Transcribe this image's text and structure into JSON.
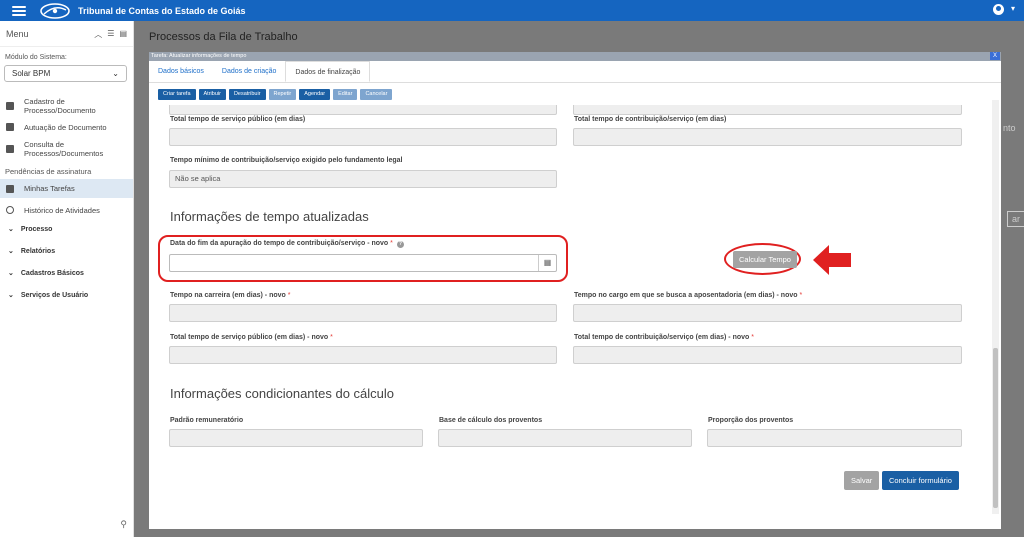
{
  "header": {
    "title": "Tribunal de Contas do Estado de Goiás"
  },
  "sidebar": {
    "menu_label": "Menu",
    "module_label": "Módulo do Sistema:",
    "module_value": "Solar BPM",
    "items": [
      {
        "label": "Cadastro de Processo/Documento"
      },
      {
        "label": "Autuação de Documento"
      },
      {
        "label": "Consulta de Processos/Documentos"
      }
    ],
    "section_label": "Pendências de assinatura",
    "tasks": [
      {
        "label": "Minhas Tarefas"
      },
      {
        "label": "Histórico de Atividades"
      }
    ],
    "groups": [
      {
        "label": "Processo"
      },
      {
        "label": "Relatórios"
      },
      {
        "label": "Cadastros Básicos"
      },
      {
        "label": "Serviços de Usuário"
      }
    ]
  },
  "page": {
    "title": "Processos da Fila de Trabalho",
    "right_fragment_1": "nto",
    "right_fragment_2": "ar"
  },
  "modal": {
    "title": "Tarefa: Atualizar informações de tempo",
    "close": "X",
    "tabs": [
      {
        "label": "Dados básicos"
      },
      {
        "label": "Dados de criação"
      },
      {
        "label": "Dados de finalização"
      }
    ],
    "toolbar": [
      {
        "label": "Criar tarefa"
      },
      {
        "label": "Atribuir"
      },
      {
        "label": "Desatribuir"
      },
      {
        "label": "Repetir"
      },
      {
        "label": "Agendar"
      },
      {
        "label": "Editar"
      },
      {
        "label": "Cancelar"
      }
    ],
    "fields": {
      "total_publico": "Total tempo de serviço público (em dias)",
      "total_contrib": "Total tempo de contribuição/serviço (em dias)",
      "tempo_minimo": "Tempo mínimo de contribuição/serviço exigido pelo fundamento legal",
      "tempo_minimo_value": "Não se aplica",
      "data_fim": "Data do fim da apuração do tempo de contribuição/serviço - novo",
      "carreira": "Tempo na carreira (em dias) - novo",
      "cargo": "Tempo no cargo em que se busca a aposentadoria (em dias) - novo",
      "total_publico_novo": "Total tempo de serviço público (em dias) - novo",
      "total_contrib_novo": "Total tempo de contribuição/serviço (em dias) - novo",
      "padrao": "Padrão remuneratório",
      "base": "Base de cálculo dos proventos",
      "proporcao": "Proporção dos proventos"
    },
    "sections": {
      "atualizadas": "Informações de tempo atualizadas",
      "condicionantes": "Informações condicionantes do cálculo"
    },
    "buttons": {
      "calcular": "Calcular Tempo",
      "salvar": "Salvar",
      "concluir": "Concluir formulário"
    },
    "required_mark": "*",
    "help_mark": "?"
  },
  "colors": {
    "brand": "#1565c0",
    "highlight": "#e02020",
    "primary_button": "#1a5fa4"
  }
}
